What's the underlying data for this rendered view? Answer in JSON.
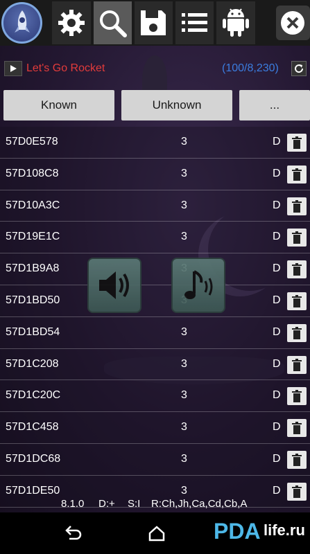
{
  "toolbar": {
    "icons": [
      "app-logo-icon",
      "gear-icon",
      "search-icon",
      "save-icon",
      "list-icon",
      "android-icon",
      "close-icon"
    ],
    "active": "search-icon"
  },
  "process": {
    "name": "Let's Go Rocket",
    "count": "(100/8,230)"
  },
  "filters": {
    "known": "Known",
    "unknown": "Unknown",
    "more": "..."
  },
  "rows": [
    {
      "address": "57D0E578",
      "value": "3",
      "type": "D"
    },
    {
      "address": "57D108C8",
      "value": "3",
      "type": "D"
    },
    {
      "address": "57D10A3C",
      "value": "3",
      "type": "D"
    },
    {
      "address": "57D19E1C",
      "value": "3",
      "type": "D"
    },
    {
      "address": "57D1B9A8",
      "value": "3",
      "type": "D"
    },
    {
      "address": "57D1BD50",
      "value": "3",
      "type": "D"
    },
    {
      "address": "57D1BD54",
      "value": "3",
      "type": "D"
    },
    {
      "address": "57D1C208",
      "value": "3",
      "type": "D"
    },
    {
      "address": "57D1C20C",
      "value": "3",
      "type": "D"
    },
    {
      "address": "57D1C458",
      "value": "3",
      "type": "D"
    },
    {
      "address": "57D1DC68",
      "value": "3",
      "type": "D"
    },
    {
      "address": "57D1DE50",
      "value": "3",
      "type": "D"
    }
  ],
  "status": {
    "version": "8.1.0",
    "d": "D:+",
    "s": "S:I",
    "regions": "R:Ch,Jh,Ca,Cd,Cb,A"
  },
  "watermark": {
    "logo_letters": "PDA",
    "logo_text": "life.ru"
  },
  "colors": {
    "process_name": "#e23b3b",
    "count": "#3b7de0",
    "filter_button": "#d4d4d4"
  }
}
